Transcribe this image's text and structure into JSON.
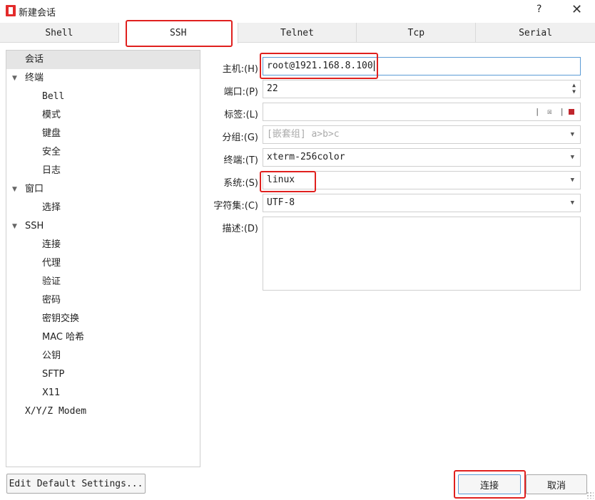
{
  "window": {
    "title": "新建会话",
    "help_label": "?",
    "close_label": "✕"
  },
  "tabs": [
    {
      "label": "Shell"
    },
    {
      "label": "SSH"
    },
    {
      "label": "Telnet"
    },
    {
      "label": "Tcp"
    },
    {
      "label": "Serial"
    }
  ],
  "sidebar": {
    "items": [
      {
        "label": "会话"
      },
      {
        "label": "终端"
      },
      {
        "label": "Bell"
      },
      {
        "label": "模式"
      },
      {
        "label": "键盘"
      },
      {
        "label": "安全"
      },
      {
        "label": "日志"
      },
      {
        "label": "窗口"
      },
      {
        "label": "选择"
      },
      {
        "label": "SSH"
      },
      {
        "label": "连接"
      },
      {
        "label": "代理"
      },
      {
        "label": "验证"
      },
      {
        "label": "密码"
      },
      {
        "label": "密钥交换"
      },
      {
        "label": "MAC 哈希"
      },
      {
        "label": "公钥"
      },
      {
        "label": "SFTP"
      },
      {
        "label": "X11"
      },
      {
        "label": "X/Y/Z Modem"
      }
    ]
  },
  "form": {
    "host": {
      "label": "主机:(H)",
      "value": "root@1921.168.8.100"
    },
    "port": {
      "label": "端口:(P)",
      "value": "22"
    },
    "tag": {
      "label": "标签:(L)",
      "value": ""
    },
    "group": {
      "label": "分组:(G)",
      "placeholder": "[嵌套组] a>b>c"
    },
    "terminal": {
      "label": "终端:(T)",
      "value": "xterm-256color"
    },
    "system": {
      "label": "系统:(S)",
      "value": "linux"
    },
    "charset": {
      "label": "字符集:(C)",
      "value": "UTF-8"
    },
    "description": {
      "label": "描述:(D)",
      "value": ""
    }
  },
  "footer": {
    "edit_defaults_label": "Edit Default Settings...",
    "connect_label": "连接",
    "cancel_label": "取消"
  },
  "colors": {
    "highlight": "#e0201e",
    "focus_border": "#5b9bd5",
    "brand": "#e32b2b"
  }
}
